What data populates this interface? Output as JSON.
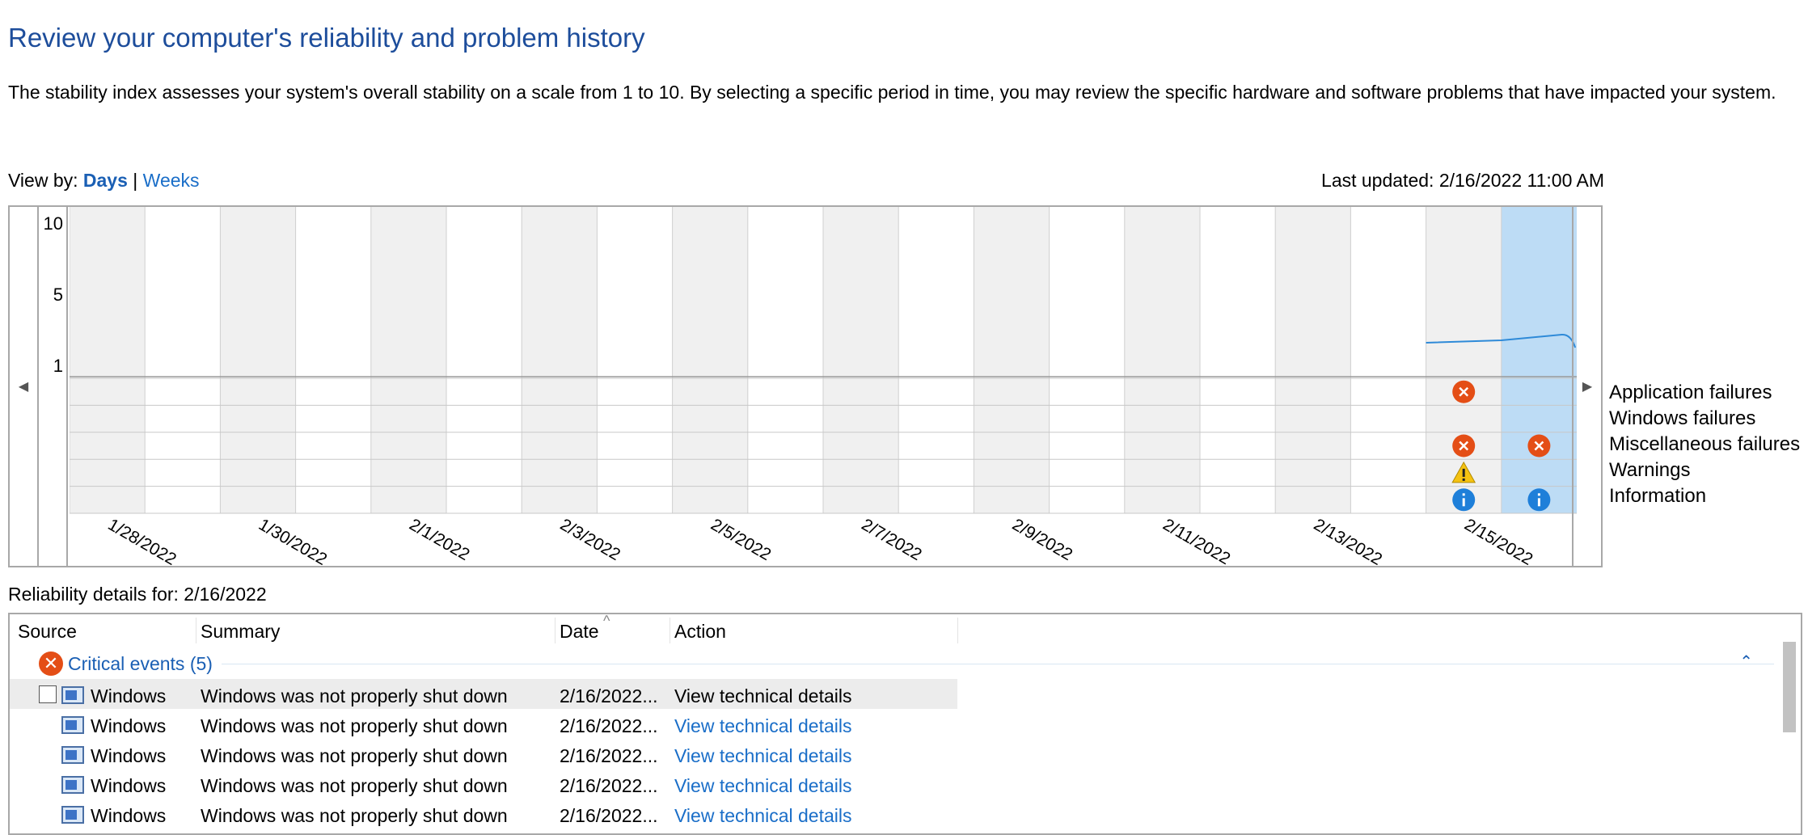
{
  "header": {
    "title": "Review your computer's reliability and problem history",
    "description": "The stability index assesses your system's overall stability on a scale from 1 to 10. By selecting a specific period in time, you may review the specific hardware and software problems that have impacted your system."
  },
  "view_by": {
    "label": "View by:",
    "days": "Days",
    "separator": "|",
    "weeks": "Weeks"
  },
  "last_updated": "Last updated: 2/16/2022 11:00 AM",
  "chart": {
    "y_ticks": [
      "10",
      "5",
      "1"
    ],
    "date_labels": [
      "1/28/2022",
      "1/30/2022",
      "2/1/2022",
      "2/3/2022",
      "2/5/2022",
      "2/7/2022",
      "2/9/2022",
      "2/11/2022",
      "2/13/2022",
      "2/15/2022"
    ],
    "selected_day_index": 19,
    "columns": 20,
    "events": [
      {
        "day_index": 18,
        "row": 0,
        "kind": "error"
      },
      {
        "day_index": 18,
        "row": 2,
        "kind": "error"
      },
      {
        "day_index": 19,
        "row": 2,
        "kind": "error"
      },
      {
        "day_index": 18,
        "row": 3,
        "kind": "warning"
      },
      {
        "day_index": 18,
        "row": 4,
        "kind": "info"
      },
      {
        "day_index": 19,
        "row": 4,
        "kind": "info"
      }
    ],
    "legend": [
      "Application failures",
      "Windows failures",
      "Miscellaneous failures",
      "Warnings",
      "Information"
    ],
    "colors": {
      "line": "#2e8ad8",
      "selected": "#bddcf5",
      "shade": "#f0f0f0",
      "error": "#e44e16",
      "warning": "#f5c211",
      "info": "#1e7fd9"
    }
  },
  "details": {
    "label": "Reliability details for: 2/16/2022",
    "columns": {
      "source": "Source",
      "summary": "Summary",
      "date": "Date",
      "action": "Action"
    },
    "sort_indicator": "^",
    "group": {
      "title": "Critical events (5)",
      "collapse_icon": "chevron-up-icon"
    },
    "rows": [
      {
        "source": "Windows",
        "summary": "Windows was not properly shut down",
        "date": "2/16/2022...",
        "action": "View technical details"
      },
      {
        "source": "Windows",
        "summary": "Windows was not properly shut down",
        "date": "2/16/2022...",
        "action": "View technical details"
      },
      {
        "source": "Windows",
        "summary": "Windows was not properly shut down",
        "date": "2/16/2022...",
        "action": "View technical details"
      },
      {
        "source": "Windows",
        "summary": "Windows was not properly shut down",
        "date": "2/16/2022...",
        "action": "View technical details"
      },
      {
        "source": "Windows",
        "summary": "Windows was not properly shut down",
        "date": "2/16/2022...",
        "action": "View technical details"
      }
    ]
  }
}
